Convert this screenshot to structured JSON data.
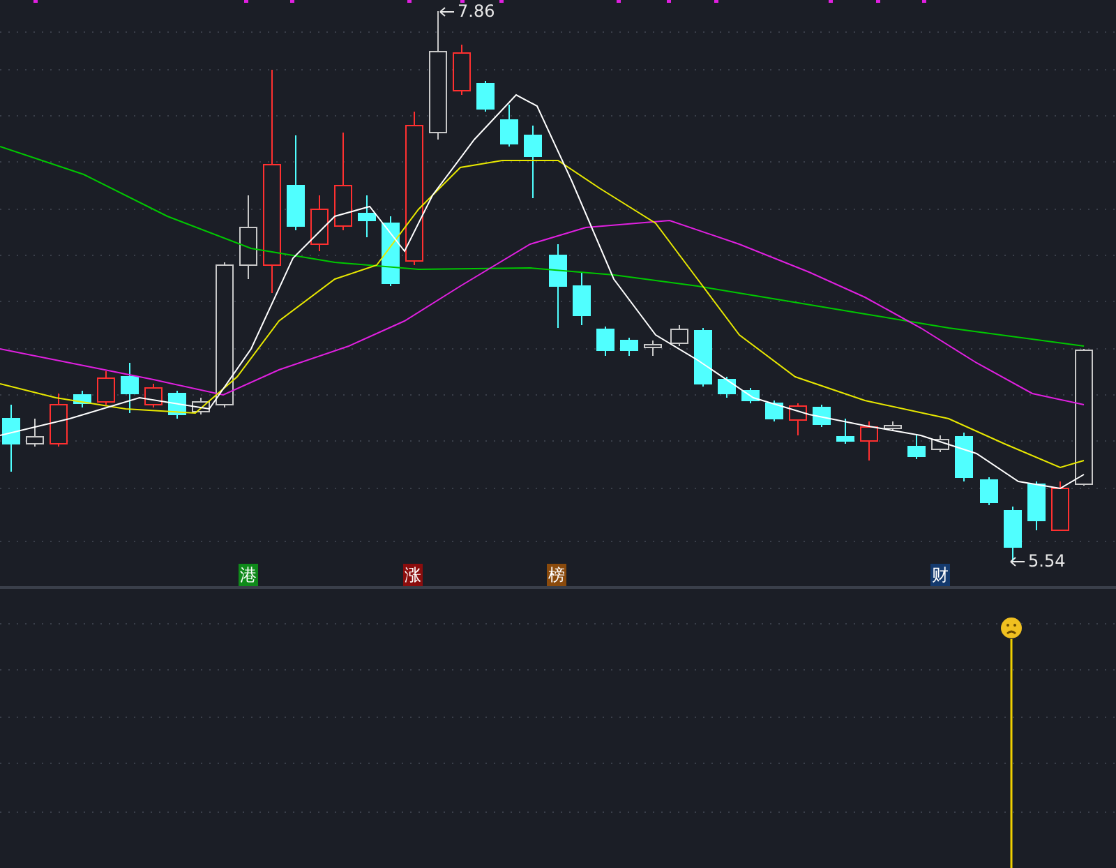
{
  "main_panel": {
    "high_label": "7.86",
    "low_label": "5.54",
    "event_markers": [
      {
        "label": "港",
        "color": "#0f8a1a"
      },
      {
        "label": "涨",
        "color": "#8b0d0d"
      },
      {
        "label": "榜",
        "color": "#8a4a0c"
      },
      {
        "label": "财",
        "color": "#143a6e"
      }
    ]
  },
  "indicator_panel": {
    "signal": {
      "kind": "sad"
    }
  }
}
